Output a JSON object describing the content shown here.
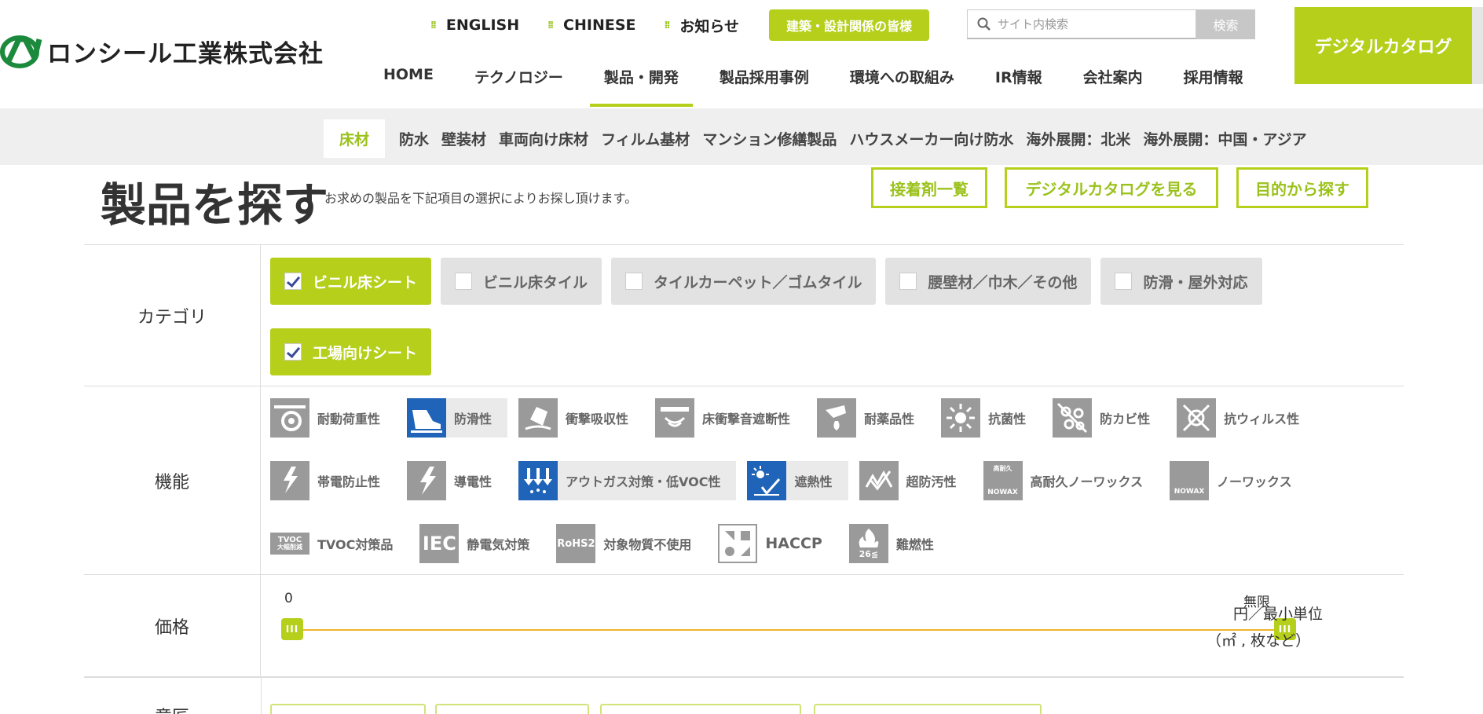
{
  "brand": {
    "name": "ロンシール工業株式会社",
    "accent": "#b5cf1b"
  },
  "util": {
    "links": [
      "ENGLISH",
      "CHINESE",
      "お知らせ"
    ],
    "pro_button": "建築・設計関係の皆様",
    "search_placeholder": "サイト内検索",
    "search_button": "検索",
    "catalog_button": "デジタルカタログ"
  },
  "gnav": [
    "HOME",
    "テクノロジー",
    "製品・開発",
    "製品採用事例",
    "環境への取組み",
    "IR情報",
    "会社案内",
    "採用情報"
  ],
  "subnav": [
    "床材",
    "防水",
    "壁装材",
    "車両向け床材",
    "フィルム基材",
    "マンション修繕製品",
    "ハウスメーカー向け防水",
    "海外展開：北米",
    "海外展開：中国・アジア"
  ],
  "page": {
    "title": "製品を探す",
    "lead": "お求めの製品を下記項目の選択によりお探し頂けます。",
    "buttons": [
      "接着剤一覧",
      "デジタルカタログを見る",
      "目的から探す"
    ]
  },
  "filters": {
    "category": {
      "label": "カテゴリ",
      "options": [
        "ビニル床シート",
        "ビニル床タイル",
        "タイルカーペット／ゴムタイル",
        "腰壁材／巾木／その他",
        "防滑・屋外対応",
        "工場向けシート"
      ],
      "checked": [
        true,
        false,
        false,
        false,
        false,
        true
      ]
    },
    "function": {
      "label": "機能",
      "row1": [
        "耐動荷重性",
        "防滑性",
        "衝撃吸収性",
        "床衝撃音遮断性",
        "耐薬品性",
        "抗菌性",
        "防カビ性",
        "抗ウィルス性"
      ],
      "row2": [
        "帯電防止性",
        "導電性",
        "アウトガス対策・低VOC性",
        "遮熱性",
        "超防汚性",
        "高耐久ノーワックス",
        "ノーワックス"
      ],
      "row3": [
        "TVOC対策品",
        "静電気対策",
        "対象物質不使用",
        "HACCP",
        "難燃性"
      ],
      "icon_text": {
        "tvoc": "TVOC",
        "tvoc_sub": "大幅削減",
        "iec": "IEC",
        "rohs": "RoHS2",
        "nowax": "NOWAX",
        "high_durability": "高耐久",
        "fire": "26≦"
      }
    },
    "price": {
      "label": "価格",
      "min_label": "0",
      "max_label": "無限",
      "unit_line1": "円／最小単位",
      "unit_line2": "（㎡ , 枚など）"
    },
    "next_label": "意匠"
  }
}
